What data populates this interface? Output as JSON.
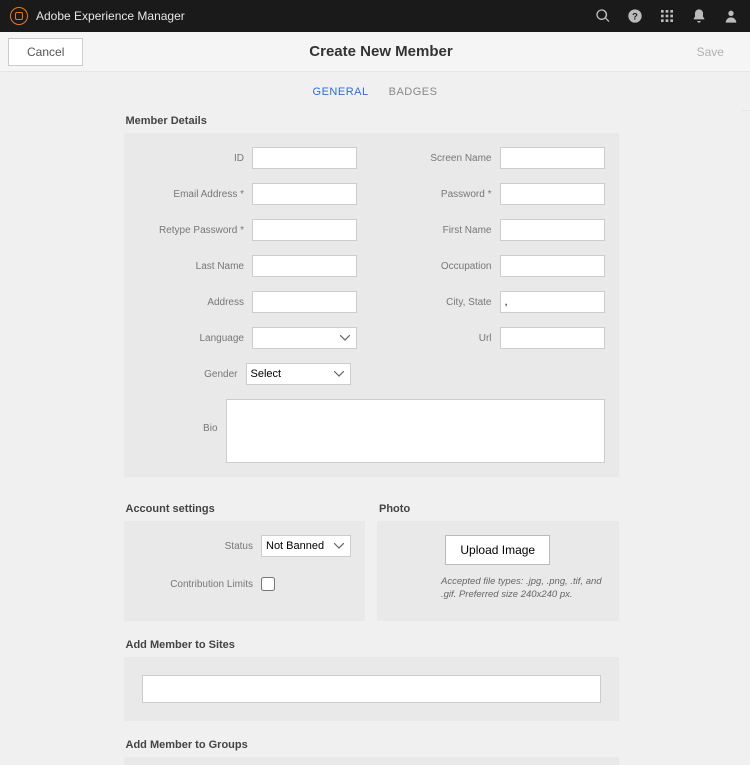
{
  "topbar": {
    "app_name": "Adobe Experience Manager"
  },
  "actionbar": {
    "cancel": "Cancel",
    "title": "Create New Member",
    "save": "Save"
  },
  "tabs": {
    "general": "GENERAL",
    "badges": "BADGES"
  },
  "sections": {
    "member_details": "Member Details",
    "account_settings": "Account settings",
    "photo": "Photo",
    "add_to_sites": "Add Member to Sites",
    "add_to_groups": "Add Member to Groups"
  },
  "fields": {
    "id": {
      "label": "ID",
      "value": ""
    },
    "screen_name": {
      "label": "Screen Name",
      "value": ""
    },
    "email": {
      "label": "Email Address *",
      "value": ""
    },
    "password": {
      "label": "Password *",
      "value": ""
    },
    "retype_password": {
      "label": "Retype Password *",
      "value": ""
    },
    "first_name": {
      "label": "First Name",
      "value": ""
    },
    "last_name": {
      "label": "Last Name",
      "value": ""
    },
    "occupation": {
      "label": "Occupation",
      "value": ""
    },
    "address": {
      "label": "Address",
      "value": ""
    },
    "city_state": {
      "label": "City, State",
      "value": ","
    },
    "language": {
      "label": "Language",
      "value": ""
    },
    "url": {
      "label": "Url",
      "value": ""
    },
    "gender": {
      "label": "Gender",
      "value": "Select"
    },
    "bio": {
      "label": "Bio",
      "value": ""
    }
  },
  "account": {
    "status": {
      "label": "Status",
      "value": "Not Banned"
    },
    "contribution_limits": {
      "label": "Contribution Limits",
      "checked": false
    }
  },
  "photo": {
    "upload_label": "Upload Image",
    "hint": "Accepted file types: .jpg, .png, .tif, and .gif. Preferred size 240x240 px."
  }
}
